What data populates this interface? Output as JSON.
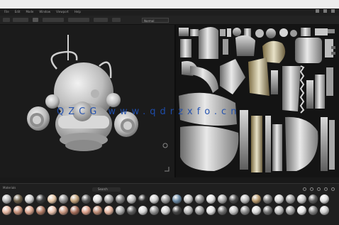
{
  "menubar": {
    "items": [
      "File",
      "Edit",
      "Mode",
      "Window",
      "Viewport",
      "Help"
    ]
  },
  "toolbar": {
    "view_mode": "Normal"
  },
  "shelf": {
    "label": "Materials",
    "search_placeholder": "Search"
  },
  "watermark": "QZCG www.qdrzxfo.cn",
  "colors": {
    "app_bg": "#191919",
    "panel_bg": "#1f1f1f",
    "watermark": "#1f4fb0"
  },
  "icons": [
    "search-icon",
    "settings-icon",
    "grid-icon",
    "list-icon",
    "add-icon",
    "close-icon"
  ]
}
